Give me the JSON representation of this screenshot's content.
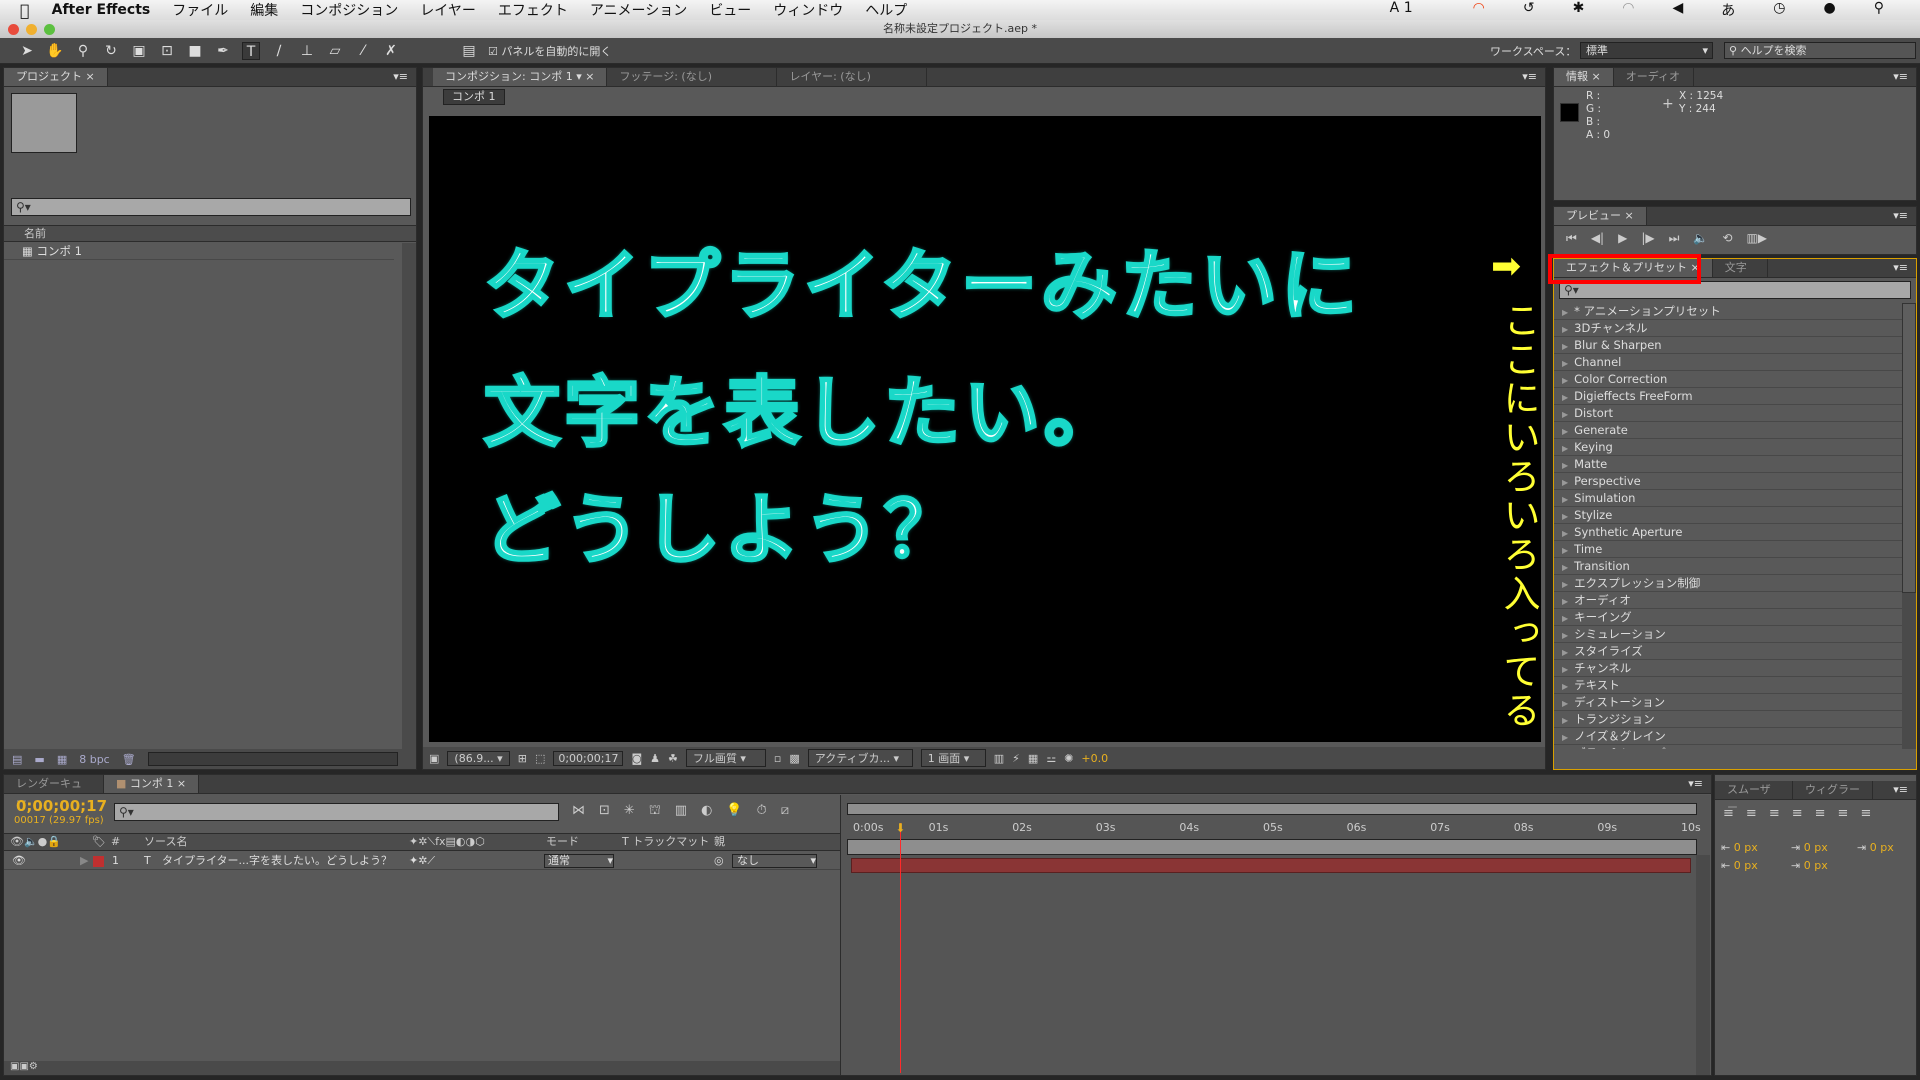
{
  "menubar": {
    "app": "After Effects",
    "items": [
      "ファイル",
      "編集",
      "コンポジション",
      "レイヤー",
      "エフェクト",
      "アニメーション",
      "ビュー",
      "ウィンドウ",
      "ヘルプ"
    ],
    "status_count": "1"
  },
  "window": {
    "title": "名称未設定プロジェクト.aep *"
  },
  "toolbar": {
    "auto_open_label": "パネルを自動的に開く",
    "auto_open_checked": true,
    "workspace_label": "ワークスペース：",
    "workspace_value": "標準",
    "help_placeholder": "ヘルプを検索"
  },
  "project": {
    "tab": "プロジェクト",
    "column_name": "名前",
    "items": [
      "コンポ 1"
    ],
    "bpc": "8 bpc"
  },
  "composition": {
    "tabs": [
      "コンポジション: コンポ 1",
      "フッテージ: (なし)",
      "レイヤー: (なし)"
    ],
    "subtab": "コンポ 1",
    "text_lines": [
      "タイプライターみたいに",
      "文字を表したい。",
      "どうしよう？"
    ],
    "annotation": "ここにいろいろ入ってる",
    "footer": {
      "zoom": "(86.9...",
      "timecode": "0;00;00;17",
      "quality": "フル画質",
      "camera": "アクティブカ...",
      "views": "1 画面",
      "exposure": "+0.0"
    }
  },
  "info": {
    "tabs": [
      "情報",
      "オーディオ"
    ],
    "r": "R :",
    "g": "G :",
    "b": "B :",
    "a": "A : 0",
    "x": "X : 1254",
    "y": "Y : 244"
  },
  "preview": {
    "tab": "プレビュー"
  },
  "effects": {
    "tabs": [
      "エフェクト＆プリセット",
      "文字"
    ],
    "highlight_color": "#ff0000",
    "items": [
      "* アニメーションプリセット",
      "3Dチャンネル",
      "Blur & Sharpen",
      "Channel",
      "Color Correction",
      "Digieffects FreeForm",
      "Distort",
      "Generate",
      "Keying",
      "Matte",
      "Perspective",
      "Simulation",
      "Stylize",
      "Synthetic Aperture",
      "Time",
      "Transition",
      "エクスプレッション制御",
      "オーディオ",
      "キーイング",
      "シミュレーション",
      "スタイライズ",
      "チャンネル",
      "テキスト",
      "ディストーション",
      "トランジション",
      "ノイズ＆グレイン",
      "ブラー＆シャープ"
    ]
  },
  "timeline": {
    "tabs": [
      "レンダーキュー",
      "コンポ 1"
    ],
    "timecode": "0;00;00;17",
    "frame_info": "00017 (29.97 fps)",
    "columns": {
      "num": "#",
      "source": "ソース名",
      "mode": "モード",
      "trkmat": "T  トラックマット",
      "parent": "親"
    },
    "layers": [
      {
        "num": "1",
        "name": "タイプライター...字を表したい。どうしよう？",
        "mode": "通常",
        "parent": "なし",
        "label_color": "#c03030"
      }
    ],
    "ruler": [
      "0:00s",
      "01s",
      "02s",
      "03s",
      "04s",
      "05s",
      "06s",
      "07s",
      "08s",
      "09s",
      "10s"
    ],
    "current_time_s": 0.567,
    "duration_s": 10
  },
  "paragraph": {
    "tabs": [
      "スムーザー",
      "ウィグラー"
    ],
    "indent": [
      "0 px",
      "0 px",
      "0 px",
      "0 px",
      "0 px"
    ]
  }
}
